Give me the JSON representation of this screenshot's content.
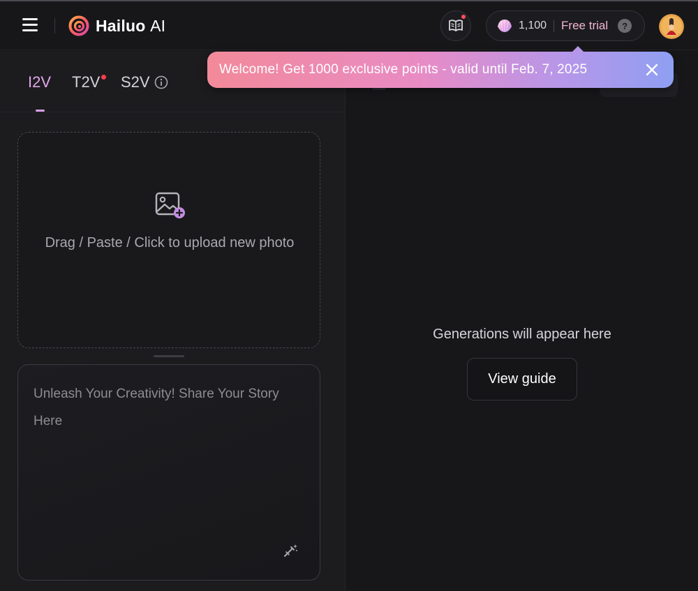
{
  "header": {
    "logo_text": "Hailuo",
    "logo_suffix": "AI",
    "points": "1,100",
    "plan_label": "Free trial",
    "help_symbol": "?"
  },
  "toast": {
    "message": "Welcome! Get 1000 exclusive points - valid until Feb. 7, 2025"
  },
  "tabs": [
    {
      "label": "I2V",
      "active": true
    },
    {
      "label": "T2V",
      "badge": true
    },
    {
      "label": "S2V"
    }
  ],
  "upload": {
    "text": "Drag / Paste / Click to upload new photo"
  },
  "prompt": {
    "placeholder": "Unleash Your Creativity! Share Your Story Here",
    "value": ""
  },
  "results": {
    "empty_text": "Generations will appear here",
    "guide_button": "View guide"
  },
  "colors": {
    "accent_tab": "#e3a6ec",
    "plan_label": "#f4b6d4",
    "badge_dot": "#ff3b4e",
    "toast_gradient": [
      "#f28a9a",
      "#e98bc4",
      "#b896e8",
      "#8f9ff2"
    ]
  },
  "icons": {
    "menu": "hamburger-icon",
    "logo": "hailuo-spiral-logo",
    "book": "book-icon",
    "points": "shell-gem-icon",
    "help": "question-icon",
    "close": "close-icon",
    "info": "info-icon",
    "upload": "image-plus-icon",
    "magic": "magic-wand-icon"
  }
}
